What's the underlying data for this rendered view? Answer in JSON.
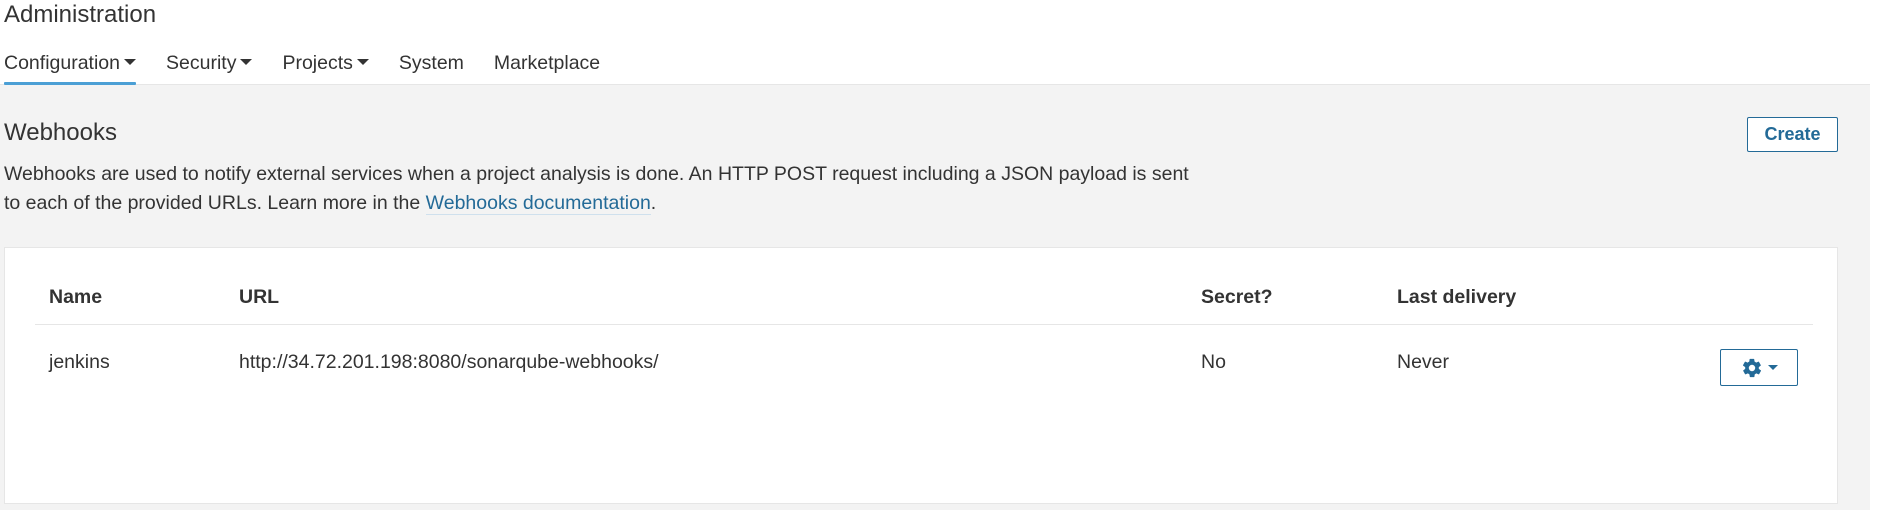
{
  "header": {
    "title": "Administration",
    "nav": [
      {
        "label": "Configuration",
        "dropdown": true,
        "active": true
      },
      {
        "label": "Security",
        "dropdown": true,
        "active": false
      },
      {
        "label": "Projects",
        "dropdown": true,
        "active": false
      },
      {
        "label": "System",
        "dropdown": false,
        "active": false
      },
      {
        "label": "Marketplace",
        "dropdown": false,
        "active": false
      }
    ]
  },
  "webhooks": {
    "title": "Webhooks",
    "create_label": "Create",
    "description_part1": "Webhooks are used to notify external services when a project analysis is done. An HTTP POST request including a JSON payload is sent to each of the provided URLs. Learn more in the ",
    "doc_link": "Webhooks documentation",
    "description_end": ".",
    "table": {
      "columns": [
        "Name",
        "URL",
        "Secret?",
        "Last delivery"
      ],
      "rows": [
        {
          "name": "jenkins",
          "url": "http://34.72.201.198:8080/sonarqube-webhooks/",
          "secret": "No",
          "last_delivery": "Never",
          "actions_icon": "gear-icon"
        }
      ]
    }
  },
  "colors": {
    "accent": "#236a97",
    "active_tab_underline": "#4b9fd5",
    "page_background": "#f3f3f3"
  }
}
